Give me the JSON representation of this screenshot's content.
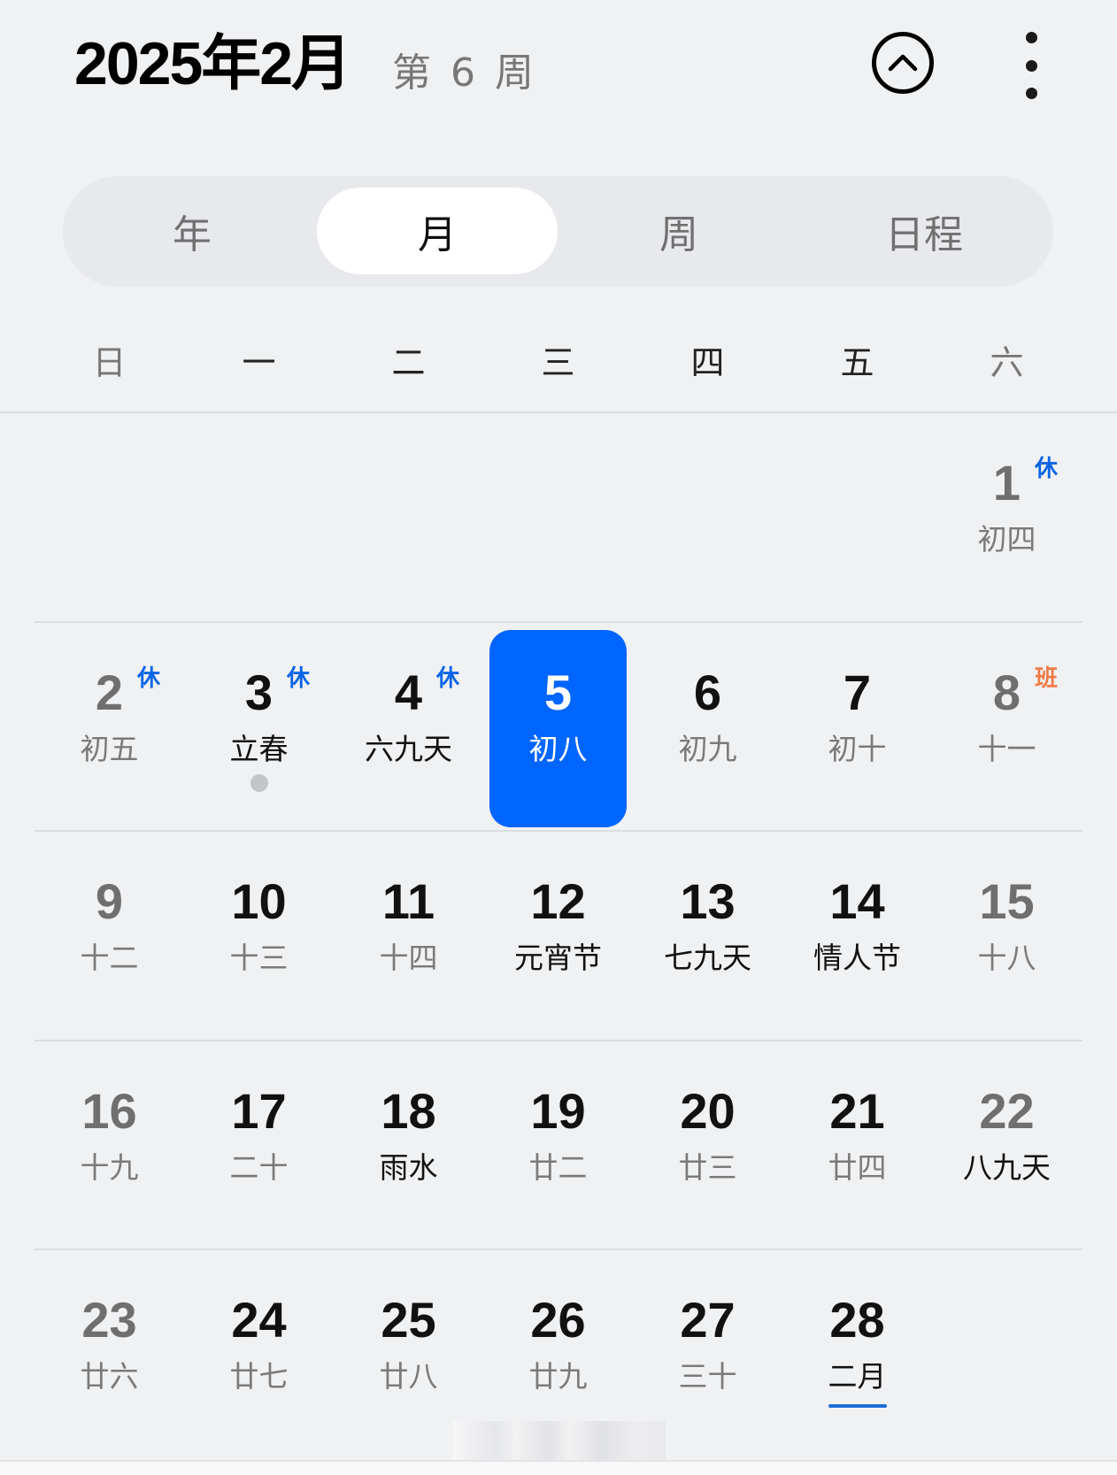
{
  "header": {
    "title": "2025年2月",
    "week_label": "第 6 周",
    "collapse_icon": "chevron-up-circle-icon",
    "more_icon": "more-vertical-icon"
  },
  "view_tabs": [
    {
      "label": "年",
      "active": false
    },
    {
      "label": "月",
      "active": true
    },
    {
      "label": "周",
      "active": false
    },
    {
      "label": "日程",
      "active": false
    }
  ],
  "weekdays": [
    "日",
    "一",
    "二",
    "三",
    "四",
    "五",
    "六"
  ],
  "colors": {
    "accent": "#0066ff",
    "rest_badge": "#0a64e6",
    "work_badge": "#f07a45",
    "background": "#f0f1f3"
  },
  "weeks": [
    [
      null,
      null,
      null,
      null,
      null,
      null,
      {
        "day": "1",
        "lunar": "初四",
        "badge": "休",
        "badge_type": "rest"
      }
    ],
    [
      {
        "day": "2",
        "lunar": "初五",
        "badge": "休",
        "badge_type": "rest"
      },
      {
        "day": "3",
        "lunar": "立春",
        "badge": "休",
        "badge_type": "rest",
        "special": true,
        "has_event": true
      },
      {
        "day": "4",
        "lunar": "六九天",
        "badge": "休",
        "badge_type": "rest",
        "special": true
      },
      {
        "day": "5",
        "lunar": "初八",
        "today": true
      },
      {
        "day": "6",
        "lunar": "初九"
      },
      {
        "day": "7",
        "lunar": "初十"
      },
      {
        "day": "8",
        "lunar": "十一",
        "badge": "班",
        "badge_type": "work"
      }
    ],
    [
      {
        "day": "9",
        "lunar": "十二"
      },
      {
        "day": "10",
        "lunar": "十三"
      },
      {
        "day": "11",
        "lunar": "十四"
      },
      {
        "day": "12",
        "lunar": "元宵节",
        "special": true
      },
      {
        "day": "13",
        "lunar": "七九天",
        "special": true
      },
      {
        "day": "14",
        "lunar": "情人节",
        "special": true
      },
      {
        "day": "15",
        "lunar": "十八"
      }
    ],
    [
      {
        "day": "16",
        "lunar": "十九"
      },
      {
        "day": "17",
        "lunar": "二十"
      },
      {
        "day": "18",
        "lunar": "雨水",
        "special": true
      },
      {
        "day": "19",
        "lunar": "廿二"
      },
      {
        "day": "20",
        "lunar": "廿三"
      },
      {
        "day": "21",
        "lunar": "廿四"
      },
      {
        "day": "22",
        "lunar": "八九天",
        "special": true
      }
    ],
    [
      {
        "day": "23",
        "lunar": "廿六"
      },
      {
        "day": "24",
        "lunar": "廿七"
      },
      {
        "day": "25",
        "lunar": "廿八"
      },
      {
        "day": "26",
        "lunar": "廿九"
      },
      {
        "day": "27",
        "lunar": "三十"
      },
      {
        "day": "28",
        "lunar": "二月",
        "special": true,
        "lunar_month_start": true
      },
      null
    ]
  ]
}
